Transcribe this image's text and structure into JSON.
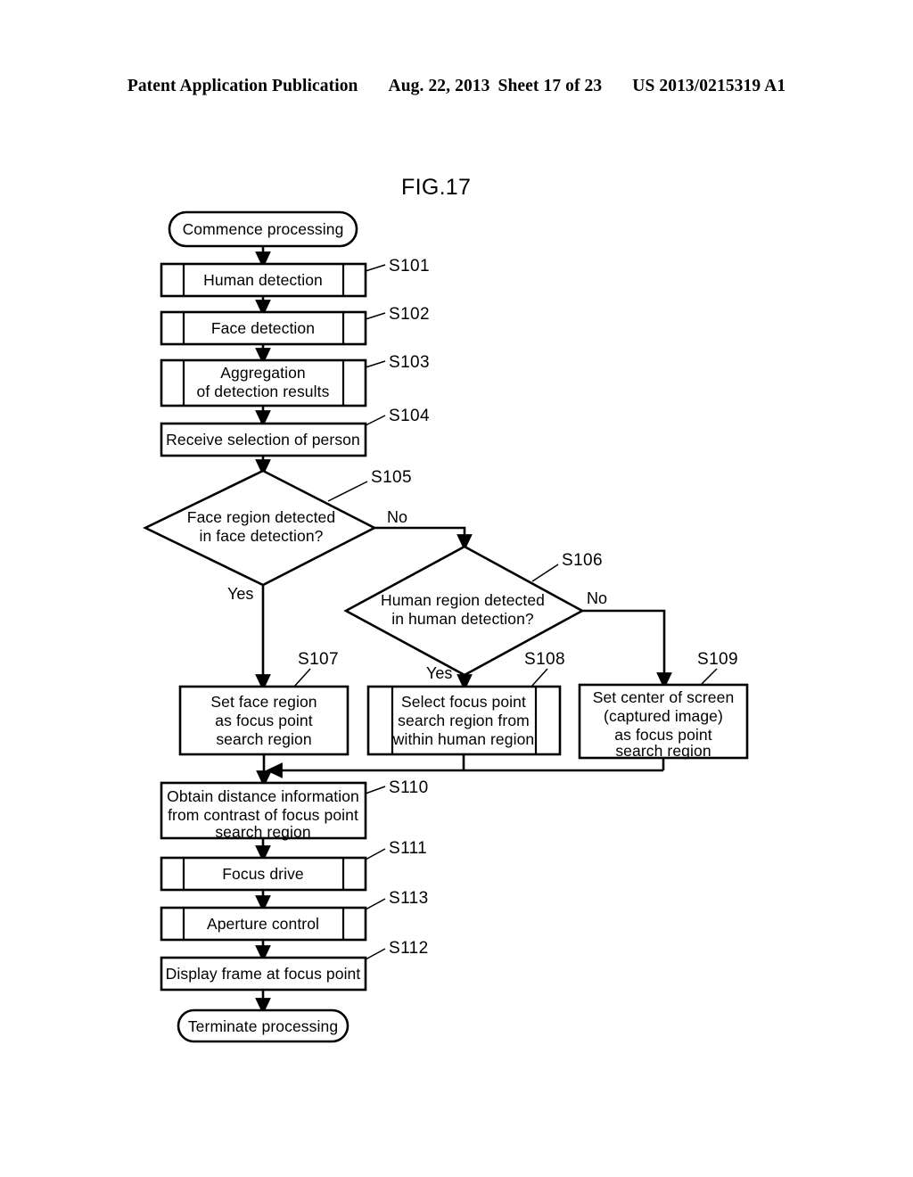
{
  "header": {
    "publication": "Patent Application Publication",
    "date": "Aug. 22, 2013",
    "sheet": "Sheet 17 of 23",
    "patent_number": "US 2013/0215319 A1"
  },
  "figure": {
    "title": "FIG.17",
    "start_terminal": "Commence processing",
    "end_terminal": "Terminate processing"
  },
  "nodes": {
    "s101": {
      "step": "S101",
      "text": "Human detection",
      "shape": "predefined-process"
    },
    "s102": {
      "step": "S102",
      "text": "Face detection",
      "shape": "predefined-process"
    },
    "s103": {
      "step": "S103",
      "line1": "Aggregation",
      "line2": "of detection results",
      "shape": "predefined-process"
    },
    "s104": {
      "step": "S104",
      "text": "Receive selection of person",
      "shape": "process"
    },
    "s105": {
      "step": "S105",
      "line1": "Face region detected",
      "line2": "in face detection?",
      "shape": "decision",
      "yes": "Yes",
      "no": "No"
    },
    "s106": {
      "step": "S106",
      "line1": "Human region detected",
      "line2": "in human detection?",
      "shape": "decision",
      "yes": "Yes",
      "no": "No"
    },
    "s107": {
      "step": "S107",
      "line1": "Set face region",
      "line2": "as focus point",
      "line3": "search region",
      "shape": "process"
    },
    "s108": {
      "step": "S108",
      "line1": "Select focus point",
      "line2": "search region from",
      "line3": "within human region",
      "shape": "predefined-process"
    },
    "s109": {
      "step": "S109",
      "line1": "Set center of screen",
      "line2": "(captured image)",
      "line3": "as focus point",
      "line4": "search region",
      "shape": "process"
    },
    "s110": {
      "step": "S110",
      "line1": "Obtain distance information",
      "line2": "from contrast of focus point",
      "line3": "search region",
      "shape": "process"
    },
    "s111": {
      "step": "S111",
      "text": "Focus drive",
      "shape": "predefined-process"
    },
    "s113": {
      "step": "S113",
      "text": "Aperture control",
      "shape": "predefined-process"
    },
    "s112": {
      "step": "S112",
      "text": "Display frame at focus point",
      "shape": "process"
    }
  }
}
